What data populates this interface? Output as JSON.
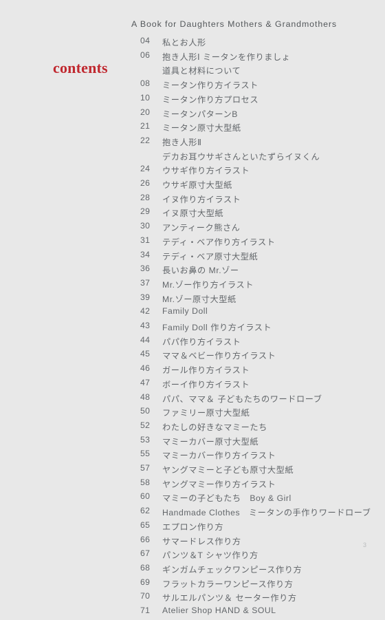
{
  "header": {
    "book_title": "A Book for Daughters Mothers & Grandmothers"
  },
  "heading": {
    "contents_label": "contents",
    "accent_color": "#c0282f"
  },
  "colors": {
    "background": "#e8e8e8",
    "body_text": "#62666a",
    "header_text": "#53575a",
    "page_number": "#b9bbbd"
  },
  "footer": {
    "page_number": "3"
  },
  "toc": {
    "entries": [
      {
        "num": "04",
        "label": "私とお人形"
      },
      {
        "num": "06",
        "label": "抱き人形Ⅰ ミータンを作りましょ"
      },
      {
        "num": "",
        "label": "道具と材料について"
      },
      {
        "num": "08",
        "label": "ミータン作り方イラスト"
      },
      {
        "num": "10",
        "label": "ミータン作り方プロセス"
      },
      {
        "num": "20",
        "label": "ミータンパターンB"
      },
      {
        "num": "21",
        "label": "ミータン原寸大型紙"
      },
      {
        "num": "22",
        "label": "抱き人形Ⅱ"
      },
      {
        "num": "",
        "label": "デカお耳ウサギさんといたずらイヌくん"
      },
      {
        "num": "24",
        "label": "ウサギ作り方イラスト"
      },
      {
        "num": "26",
        "label": "ウサギ原寸大型紙"
      },
      {
        "num": "28",
        "label": "イヌ作り方イラスト"
      },
      {
        "num": "29",
        "label": "イヌ原寸大型紙"
      },
      {
        "num": "30",
        "label": "アンティーク熊さん"
      },
      {
        "num": "31",
        "label": "テディ・ベア作り方イラスト"
      },
      {
        "num": "34",
        "label": "テディ・ベア原寸大型紙"
      },
      {
        "num": "36",
        "label": "長いお鼻の Mr.ゾー"
      },
      {
        "num": "37",
        "label": "Mr.ゾー作り方イラスト"
      },
      {
        "num": "39",
        "label": "Mr.ゾー原寸大型紙"
      },
      {
        "num": "42",
        "label": "Family Doll"
      },
      {
        "num": "43",
        "label": "Family Doll 作り方イラスト"
      },
      {
        "num": "44",
        "label": "パパ作り方イラスト"
      },
      {
        "num": "45",
        "label": "ママ＆ベビー作り方イラスト"
      },
      {
        "num": "46",
        "label": "ガール作り方イラスト"
      },
      {
        "num": "47",
        "label": "ボーイ作り方イラスト"
      },
      {
        "num": "48",
        "label": "パパ、ママ＆ 子どもたちのワードローブ"
      },
      {
        "num": "50",
        "label": "ファミリー原寸大型紙"
      },
      {
        "num": "52",
        "label": "わたしの好きなマミーたち"
      },
      {
        "num": "53",
        "label": "マミーカバー原寸大型紙"
      },
      {
        "num": "55",
        "label": "マミーカバー作り方イラスト"
      },
      {
        "num": "57",
        "label": "ヤングマミーと子ども原寸大型紙"
      },
      {
        "num": "58",
        "label": "ヤングマミー作り方イラスト"
      },
      {
        "num": "60",
        "label": "マミーの子どもたち　Boy & Girl"
      },
      {
        "num": "62",
        "label": "Handmade Clothes　ミータンの手作りワードローブ"
      },
      {
        "num": "65",
        "label": "エプロン作り方"
      },
      {
        "num": "66",
        "label": "サマードレス作り方"
      },
      {
        "num": "67",
        "label": "パンツ＆T シャツ作り方"
      },
      {
        "num": "68",
        "label": "ギンガムチェックワンピース作り方"
      },
      {
        "num": "69",
        "label": "フラットカラーワンピース作り方"
      },
      {
        "num": "70",
        "label": "サルエルパンツ＆ セーター作り方"
      },
      {
        "num": "71",
        "label": "Atelier Shop  HAND & SOUL"
      }
    ]
  }
}
